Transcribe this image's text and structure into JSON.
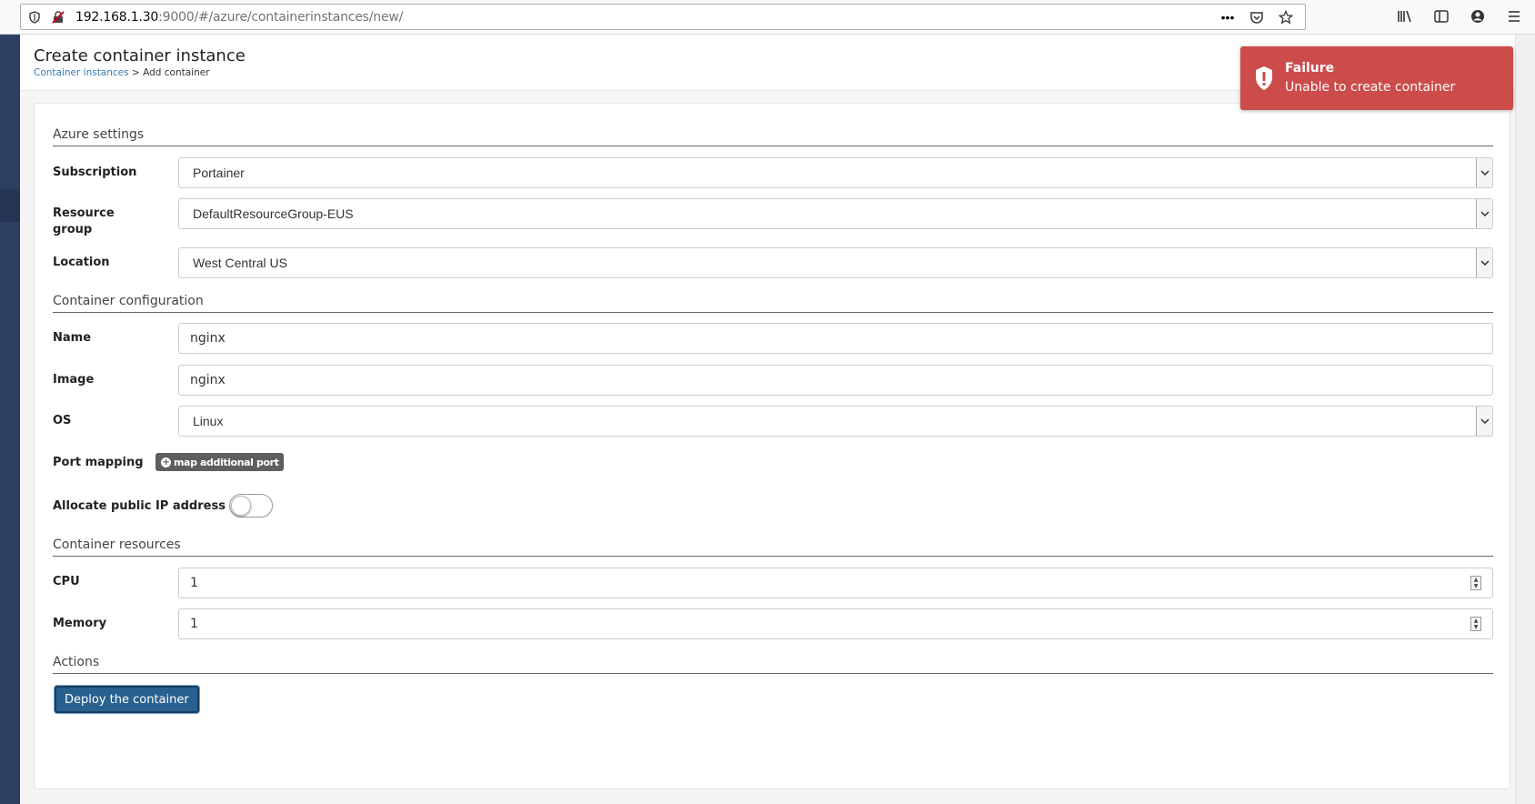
{
  "browser": {
    "url_host": "192.168.1.30",
    "url_rest": ":9000/#/azure/containerinstances/new/"
  },
  "header": {
    "title": "Create container instance",
    "breadcrumb_link": "Container instances",
    "breadcrumb_current": "> Add container"
  },
  "sections": {
    "azure": "Azure settings",
    "container": "Container configuration",
    "resources": "Container resources",
    "actions": "Actions"
  },
  "azure": {
    "subscription_label": "Subscription",
    "subscription_value": "Portainer",
    "resource_group_label_1": "Resource",
    "resource_group_label_2": "group",
    "resource_group_value": "DefaultResourceGroup-EUS",
    "location_label": "Location",
    "location_value": "West Central US"
  },
  "container": {
    "name_label": "Name",
    "name_value": "nginx",
    "image_label": "Image",
    "image_value": "nginx",
    "os_label": "OS",
    "os_value": "Linux",
    "port_label": "Port mapping",
    "port_button": "map additional port",
    "public_ip_label": "Allocate public IP address",
    "public_ip_enabled": false
  },
  "resources": {
    "cpu_label": "CPU",
    "cpu_value": "1",
    "memory_label": "Memory",
    "memory_value": "1"
  },
  "actions": {
    "deploy_label": "Deploy the container"
  },
  "toast": {
    "title": "Failure",
    "message": "Unable to create container",
    "color": "#cc4b4b"
  },
  "colors": {
    "sidebar": "#2d3e63",
    "primary_button": "#286090",
    "link": "#337ab7"
  }
}
